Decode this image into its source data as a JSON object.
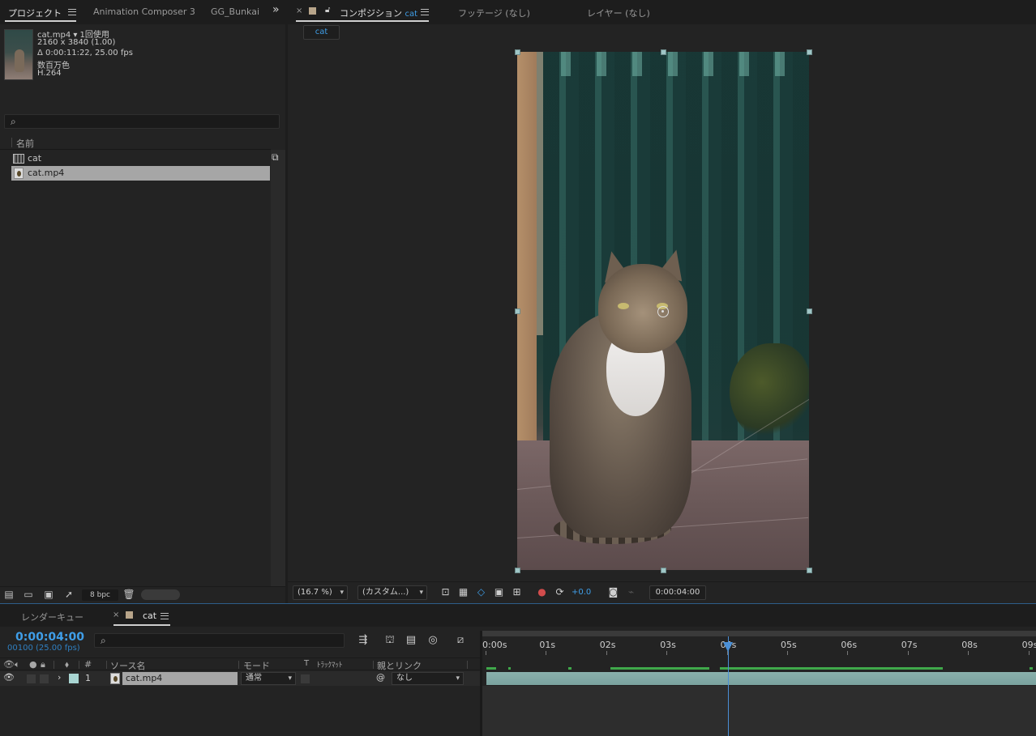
{
  "project_panel": {
    "tab_project": "プロジェクト",
    "tab_animation_composer": "Animation Composer 3",
    "tab_gg_bunkai": "GG_Bunkai",
    "overflow_glyph": "»",
    "footage_info": {
      "name_line": "cat.mp4 ▾  1回使用",
      "resolution": "2160 x 3840 (1.00)",
      "duration": "Δ 0:00:11:22, 25.00 fps",
      "colors": "数百万色",
      "codec": "H.264"
    },
    "search_placeholder": "",
    "column_name": "名前",
    "items": [
      {
        "name": "cat",
        "type": "composition"
      },
      {
        "name": "cat.mp4",
        "type": "footage"
      }
    ],
    "bpc": "8 bpc"
  },
  "comp_panel": {
    "close": "×",
    "tab_comp_prefix": "コンポジション",
    "tab_comp_name": "cat",
    "tab_footage": "フッテージ (なし)",
    "tab_layer": "レイヤー (なし)",
    "breadcrumb": "cat",
    "zoom": "(16.7 %)",
    "resolution": "(カスタム...)",
    "exposure": "+0.0",
    "timecode": "0:00:04:00"
  },
  "timeline": {
    "tab_render_queue": "レンダーキュー",
    "close": "×",
    "tab_comp": "cat",
    "current_time": "0:00:04:00",
    "frame_info": "00100 (25.00 fps)",
    "columns": {
      "hash": "#",
      "source_name": "ソース名",
      "mode": "モード",
      "t": "T",
      "track_matte": "ﾄﾗｯｸﾏｯﾄ",
      "parent": "親とリンク"
    },
    "layers": [
      {
        "number": "1",
        "source": "cat.mp4",
        "mode": "通常",
        "parent": "なし"
      }
    ],
    "ruler_labels": [
      "0:00s",
      "01s",
      "02s",
      "03s",
      "04s",
      "05s",
      "06s",
      "07s",
      "08s",
      "09s"
    ],
    "playhead_seconds": 4,
    "visible_seconds": 9
  },
  "colors": {
    "accent_blue": "#3f9ee8",
    "label_cyan": "#a9d5d2",
    "cache_green": "#3fa84a"
  },
  "icons": {
    "menu": "hamburger-icon",
    "lock": "lock-icon",
    "search": "search-icon",
    "flowchart": "flowchart-icon",
    "camera": "camera-icon",
    "trash": "trash-icon",
    "eye": "eye-icon",
    "audio": "speaker-icon",
    "solo": "solo-icon"
  }
}
